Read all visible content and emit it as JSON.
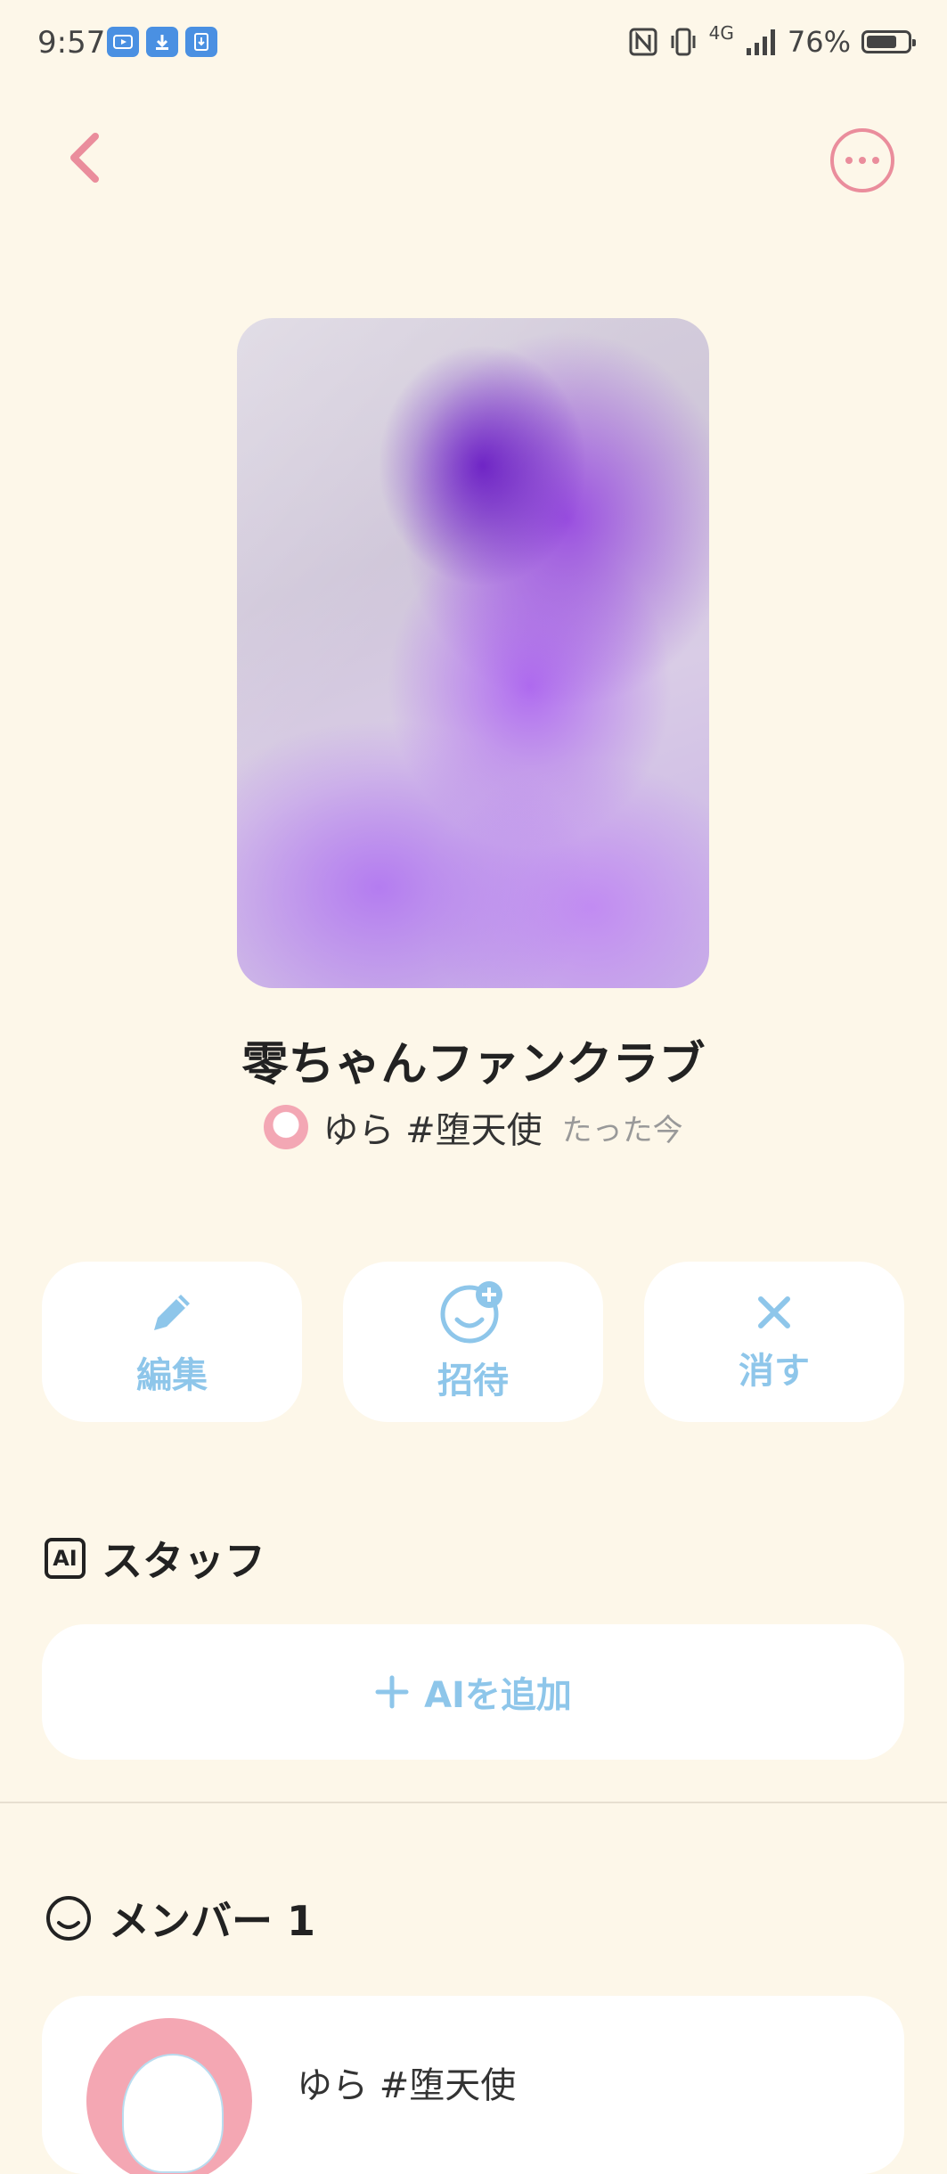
{
  "status_bar": {
    "time": "9:57",
    "left_icons": [
      "youtube-icon",
      "download-icon",
      "download-box-icon"
    ],
    "right_icons": [
      "nfc-icon",
      "vibrate-icon",
      "signal-4g-icon"
    ],
    "network": "4G",
    "battery_percent": "76%",
    "battery_level": 0.76
  },
  "topbar": {
    "back_icon": "chevron-left-icon",
    "more_icon": "more-horizontal-icon",
    "accent_color": "#ea8d9c"
  },
  "club": {
    "title": "零ちゃんファンクラブ",
    "owner": "ゆら #堕天使",
    "time": "たった今"
  },
  "actions": [
    {
      "label": "編集",
      "icon": "pencil-icon"
    },
    {
      "label": "招待",
      "icon": "invite-face-icon"
    },
    {
      "label": "消す",
      "icon": "close-icon"
    }
  ],
  "staff": {
    "title": "スタッフ",
    "icon_text": "AI",
    "add_label": "AIを追加"
  },
  "members": {
    "title": "メンバー 1",
    "items": [
      {
        "name": "ゆら #堕天使"
      }
    ]
  },
  "colors": {
    "background": "#fdf7e9",
    "button_text": "#8ec6ea",
    "card": "#ffffff"
  }
}
